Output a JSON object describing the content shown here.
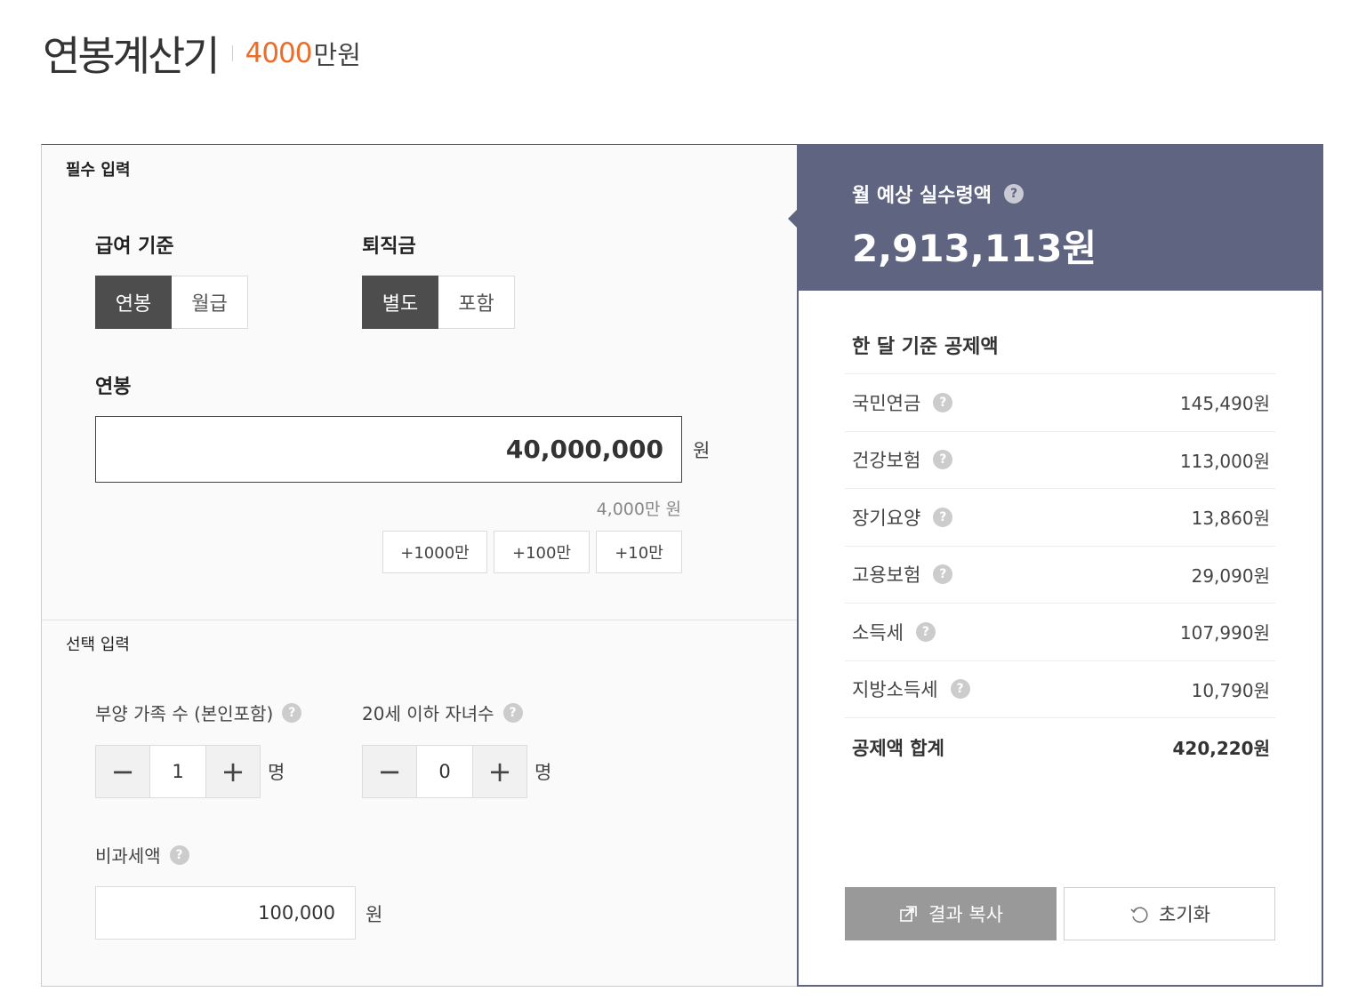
{
  "header": {
    "title": "연봉계산기",
    "amount": "4000",
    "unit": "만원"
  },
  "inputs": {
    "required_title": "필수 입력",
    "pay_basis": {
      "label": "급여 기준",
      "options": [
        "연봉",
        "월급"
      ],
      "selected": "연봉"
    },
    "severance": {
      "label": "퇴직금",
      "options": [
        "별도",
        "포함"
      ],
      "selected": "별도"
    },
    "salary": {
      "label": "연봉",
      "value": "40,000,000",
      "unit": "원",
      "hint": "4,000만 원",
      "quick_add": [
        "+1000만",
        "+100만",
        "+10만"
      ]
    },
    "optional_title": "선택 입력",
    "dependents": {
      "label": "부양 가족 수 (본인포함)",
      "value": "1",
      "unit": "명"
    },
    "children": {
      "label": "20세 이하 자녀수",
      "value": "0",
      "unit": "명"
    },
    "nontax": {
      "label": "비과세액",
      "value": "100,000",
      "unit": "원"
    }
  },
  "result": {
    "monthly_label": "월 예상 실수령액",
    "monthly_value": "2,913,113원",
    "deduction_title": "한 달 기준 공제액",
    "deductions": [
      {
        "name": "국민연금",
        "amount": "145,490원"
      },
      {
        "name": "건강보험",
        "amount": "113,000원"
      },
      {
        "name": "장기요양",
        "amount": "13,860원"
      },
      {
        "name": "고용보험",
        "amount": "29,090원"
      },
      {
        "name": "소득세",
        "amount": "107,990원"
      },
      {
        "name": "지방소득세",
        "amount": "10,790원"
      }
    ],
    "total_label": "공제액 합계",
    "total_amount": "420,220원",
    "copy_label": "결과 복사",
    "reset_label": "초기화"
  },
  "icons": {
    "help": "?",
    "minus": "−",
    "plus": "+"
  },
  "colors": {
    "accent": "#ec6c2a",
    "result_bg": "#5f6480",
    "active_toggle": "#4d4d4d"
  }
}
